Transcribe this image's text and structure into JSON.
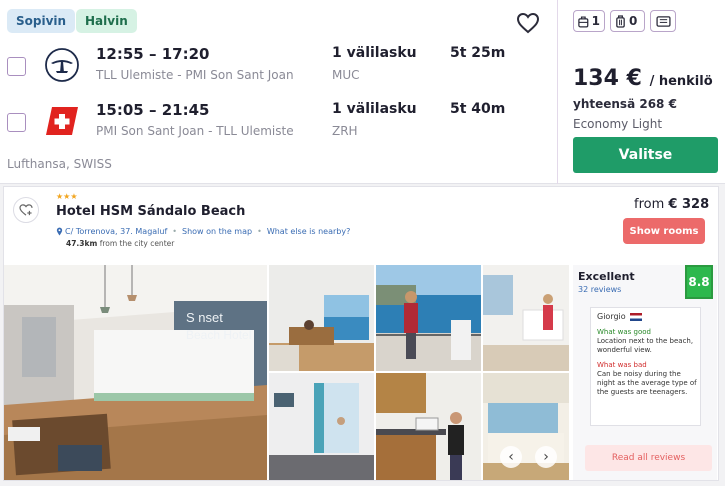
{
  "flight": {
    "badges": {
      "cheapest": "Sopivin",
      "fastest": "Halvin"
    },
    "outbound": {
      "times": "12:55 – 17:20",
      "route": "TLL Ulemiste - PMI Son Sant Joan",
      "stops": "1 välilasku",
      "via": "MUC",
      "duration": "5t 25m",
      "airline_icon": "lufthansa-logo"
    },
    "return": {
      "times": "15:05 – 21:45",
      "route": "PMI Son Sant Joan - TLL Ulemiste",
      "stops": "1 välilasku",
      "via": "ZRH",
      "duration": "5t 40m",
      "airline_icon": "swiss-logo"
    },
    "carriers": "Lufthansa, SWISS",
    "bags": {
      "personal": "1",
      "cabin": "0"
    },
    "price": {
      "amount": "134 €",
      "per": "/ henkilö",
      "total": "yhteensä 268 €",
      "fare": "Economy Light"
    },
    "select_label": "Valitse",
    "colors": {
      "select_button": "#1f9c68",
      "checkbox_border": "#a98fbf"
    }
  },
  "hotel": {
    "stars": "★★★",
    "name": "Hotel HSM Sándalo Beach",
    "address": "C/ Torrenova, 37. Magaluf",
    "map_link": "Show on the map",
    "nearby_link": "What else is nearby?",
    "distance_value": "47.3km",
    "distance_suffix": " from the city center",
    "from_label": "from",
    "from_price": "€ 328",
    "show_rooms_label": "Show rooms",
    "photo_sign": "Sunset Beach Hotel",
    "reviews": {
      "label": "Excellent",
      "count": "32 reviews",
      "score": "8.8",
      "reviewer": "Giorgio",
      "good_label": "What was good",
      "good_text": "Location next to the beach, wonderful view.",
      "bad_label": "What was bad",
      "bad_text": "Can be noisy during the night as the average type of the guests are teenagers.",
      "read_all": "Read all reviews"
    },
    "colors": {
      "show_rooms": "#ec6a6a",
      "score": "#2db84d"
    }
  }
}
